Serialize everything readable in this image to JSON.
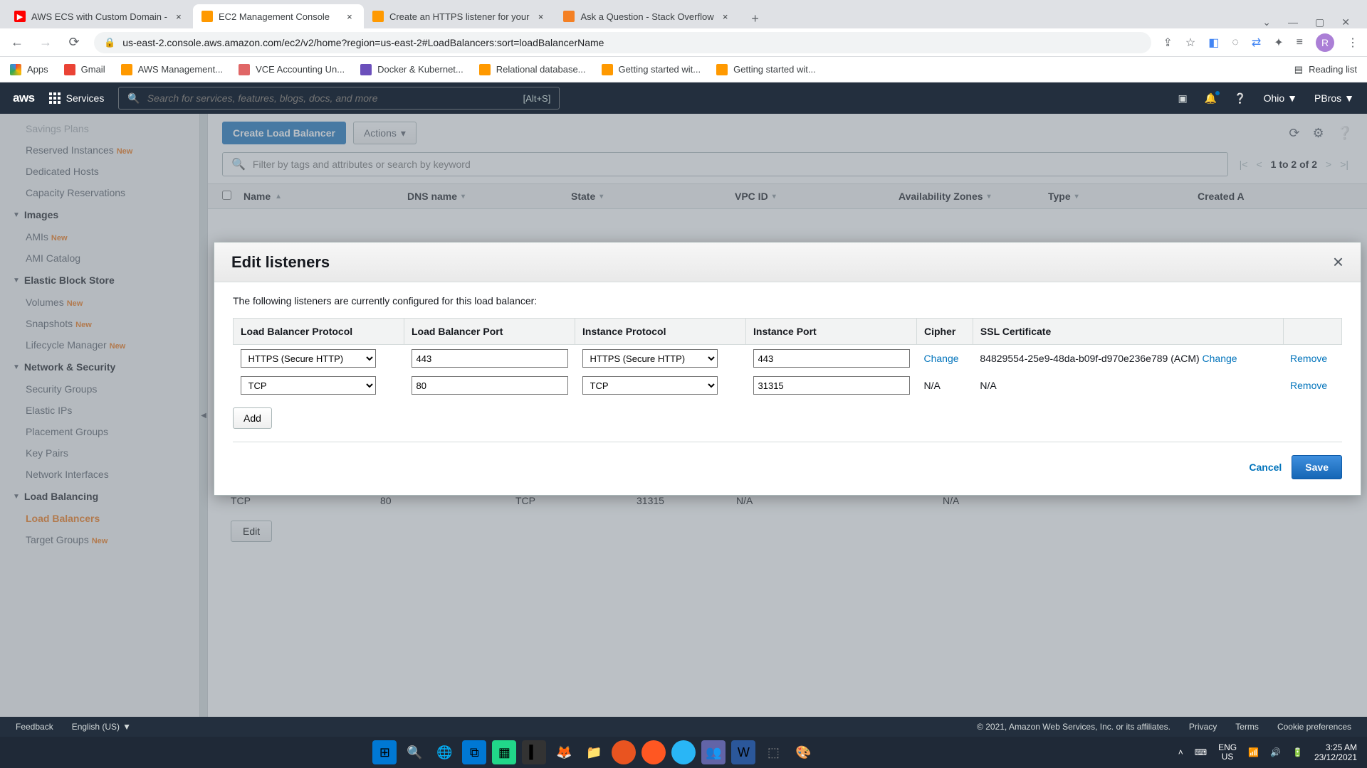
{
  "tabs": [
    {
      "title": "AWS ECS with Custom Domain -",
      "icon": "yt"
    },
    {
      "title": "EC2 Management Console",
      "icon": "aws",
      "active": true
    },
    {
      "title": "Create an HTTPS listener for your",
      "icon": "aws"
    },
    {
      "title": "Ask a Question - Stack Overflow",
      "icon": "so"
    }
  ],
  "url": "us-east-2.console.aws.amazon.com/ec2/v2/home?region=us-east-2#LoadBalancers:sort=loadBalancerName",
  "bookmarks": [
    {
      "label": "Apps",
      "ico": "#ea4335"
    },
    {
      "label": "Gmail",
      "ico": "#ea4335"
    },
    {
      "label": "AWS Management...",
      "ico": "#ff9900"
    },
    {
      "label": "VCE Accounting Un...",
      "ico": "#e06666"
    },
    {
      "label": "Docker & Kubernet...",
      "ico": "#6b4fbb"
    },
    {
      "label": "Relational database...",
      "ico": "#ff9900"
    },
    {
      "label": "Getting started wit...",
      "ico": "#ff9900"
    },
    {
      "label": "Getting started wit...",
      "ico": "#ff9900"
    }
  ],
  "reading_list": "Reading list",
  "aws": {
    "services": "Services",
    "search_placeholder": "Search for services, features, blogs, docs, and more",
    "search_kbd": "[Alt+S]",
    "region": "Ohio",
    "account": "PBros"
  },
  "sidebar": {
    "g0_items": [
      {
        "label": "Savings Plans"
      },
      {
        "label": "Reserved Instances",
        "new": true
      },
      {
        "label": "Dedicated Hosts"
      },
      {
        "label": "Capacity Reservations"
      }
    ],
    "g1": "Images",
    "g1_items": [
      {
        "label": "AMIs",
        "new": true
      },
      {
        "label": "AMI Catalog"
      }
    ],
    "g2": "Elastic Block Store",
    "g2_items": [
      {
        "label": "Volumes",
        "new": true
      },
      {
        "label": "Snapshots",
        "new": true
      },
      {
        "label": "Lifecycle Manager",
        "new": true
      }
    ],
    "g3": "Network & Security",
    "g3_items": [
      {
        "label": "Security Groups"
      },
      {
        "label": "Elastic IPs"
      },
      {
        "label": "Placement Groups"
      },
      {
        "label": "Key Pairs"
      },
      {
        "label": "Network Interfaces"
      }
    ],
    "g4": "Load Balancing",
    "g4_items": [
      {
        "label": "Load Balancers",
        "selected": true
      },
      {
        "label": "Target Groups",
        "new": true
      }
    ]
  },
  "toolbar": {
    "create": "Create Load Balancer",
    "actions": "Actions"
  },
  "filter": {
    "placeholder": "Filter by tags and attributes or search by keyword",
    "pager": "1 to 2 of 2"
  },
  "columns": [
    "Name",
    "DNS name",
    "State",
    "VPC ID",
    "Availability Zones",
    "Type",
    "Created A"
  ],
  "modal": {
    "title": "Edit listeners",
    "desc": "The following listeners are currently configured for this load balancer:",
    "headers": [
      "Load Balancer Protocol",
      "Load Balancer Port",
      "Instance Protocol",
      "Instance Port",
      "Cipher",
      "SSL Certificate"
    ],
    "rows": [
      {
        "lbp": "HTTPS (Secure HTTP)",
        "lbport": "443",
        "ip": "HTTPS (Secure HTTP)",
        "iport": "443",
        "cipher": "Change",
        "ssl": "84829554-25e9-48da-b09f-d970e236e789 (ACM)",
        "ssl_action": "Change",
        "remove": "Remove"
      },
      {
        "lbp": "TCP",
        "lbport": "80",
        "ip": "TCP",
        "iport": "31315",
        "cipher": "N/A",
        "ssl": "N/A",
        "remove": "Remove"
      }
    ],
    "add": "Add",
    "cancel": "Cancel",
    "save": "Save"
  },
  "bg": {
    "row": {
      "proto": "TCP",
      "port": "80",
      "iproto": "TCP",
      "iport": "31315",
      "cipher": "N/A",
      "ssl": "N/A"
    },
    "edit": "Edit"
  },
  "footer": {
    "feedback": "Feedback",
    "lang": "English (US)",
    "copy": "© 2021, Amazon Web Services, Inc. or its affiliates.",
    "links": [
      "Privacy",
      "Terms",
      "Cookie preferences"
    ]
  },
  "taskbar": {
    "lang1": "ENG",
    "lang2": "US",
    "time": "3:25 AM",
    "date": "23/12/2021"
  }
}
